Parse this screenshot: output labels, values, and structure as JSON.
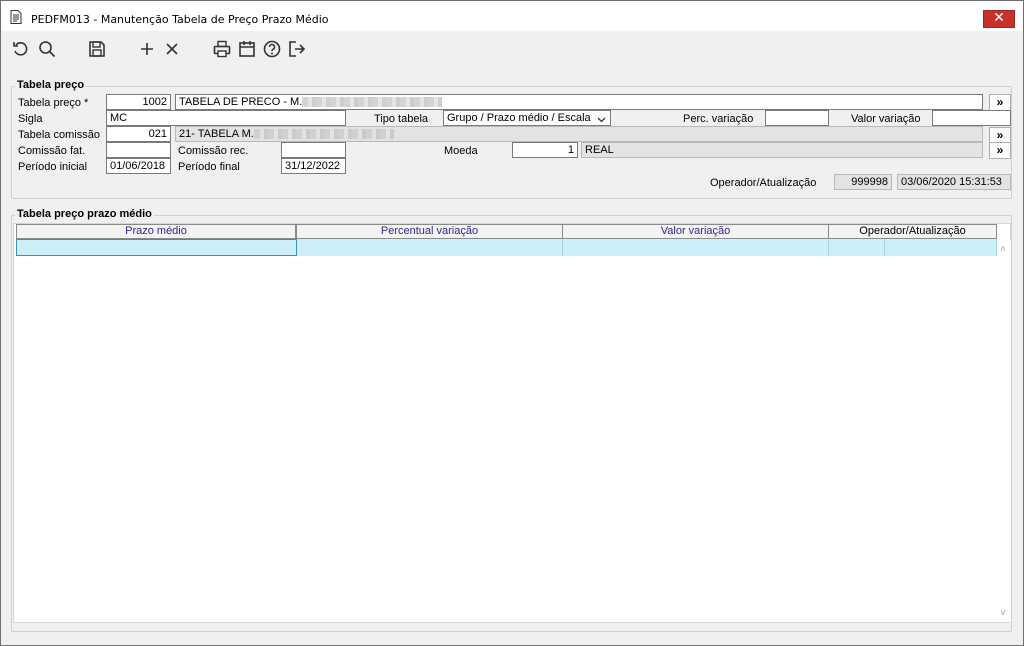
{
  "window": {
    "title": "PEDFM013 - Manutenção Tabela de Preço Prazo Médio",
    "close_symbol": "✕",
    "icon": "document-icon"
  },
  "toolbar": {
    "buttons": [
      {
        "name": "refresh",
        "icon": "refresh-icon"
      },
      {
        "name": "search",
        "icon": "search-icon"
      },
      {
        "name": "save",
        "icon": "save-icon"
      },
      {
        "name": "add",
        "icon": "plus-icon"
      },
      {
        "name": "delete",
        "icon": "close-icon"
      },
      {
        "name": "print",
        "icon": "print-icon"
      },
      {
        "name": "calendar",
        "icon": "calendar-icon"
      },
      {
        "name": "help",
        "icon": "help-icon"
      },
      {
        "name": "exit",
        "icon": "exit-icon"
      }
    ]
  },
  "price_table": {
    "legend": "Tabela preço",
    "tabela_preco_label": "Tabela preço *",
    "tabela_preco_code": "1002",
    "tabela_preco_desc": "TABELA DE PRECO - M.",
    "sigla_label": "Sigla",
    "sigla_value": "MC",
    "tipo_tabela_label": "Tipo tabela",
    "tipo_tabela_value": "Grupo / Prazo médio / Escala",
    "perc_variacao_label": "Perc. variação",
    "perc_variacao_value": "",
    "valor_variacao_label": "Valor variação",
    "valor_variacao_value": "",
    "tabela_comissao_label": "Tabela comissão",
    "tabela_comissao_code": "021",
    "tabela_comissao_desc": "21- TABELA M.",
    "comissao_fat_label": "Comissão fat.",
    "comissao_fat_value": "",
    "comissao_rec_label": "Comissão rec.",
    "comissao_rec_value": "",
    "moeda_label": "Moeda",
    "moeda_code": "1",
    "moeda_desc": "REAL",
    "periodo_inicial_label": "Período inicial",
    "periodo_inicial_value": "01/06/2018",
    "periodo_final_label": "Período final",
    "periodo_final_value": "31/12/2022",
    "operador_label": "Operador/Atualização",
    "operador_value": "999998",
    "atualizacao_value": "03/06/2020 15:31:53",
    "more_symbol": "»"
  },
  "prazo_table": {
    "legend": "Tabela preço prazo médio",
    "columns": [
      "Prazo médio",
      "Percentual variação",
      "Valor variação",
      "Operador/Atualização"
    ],
    "rows": [],
    "scroll_up": "˄",
    "scroll_down": "˅"
  },
  "colors": {
    "selected_row": "#cdeff7",
    "close_button": "#c8312a",
    "header_text": "#2b2b8a"
  }
}
